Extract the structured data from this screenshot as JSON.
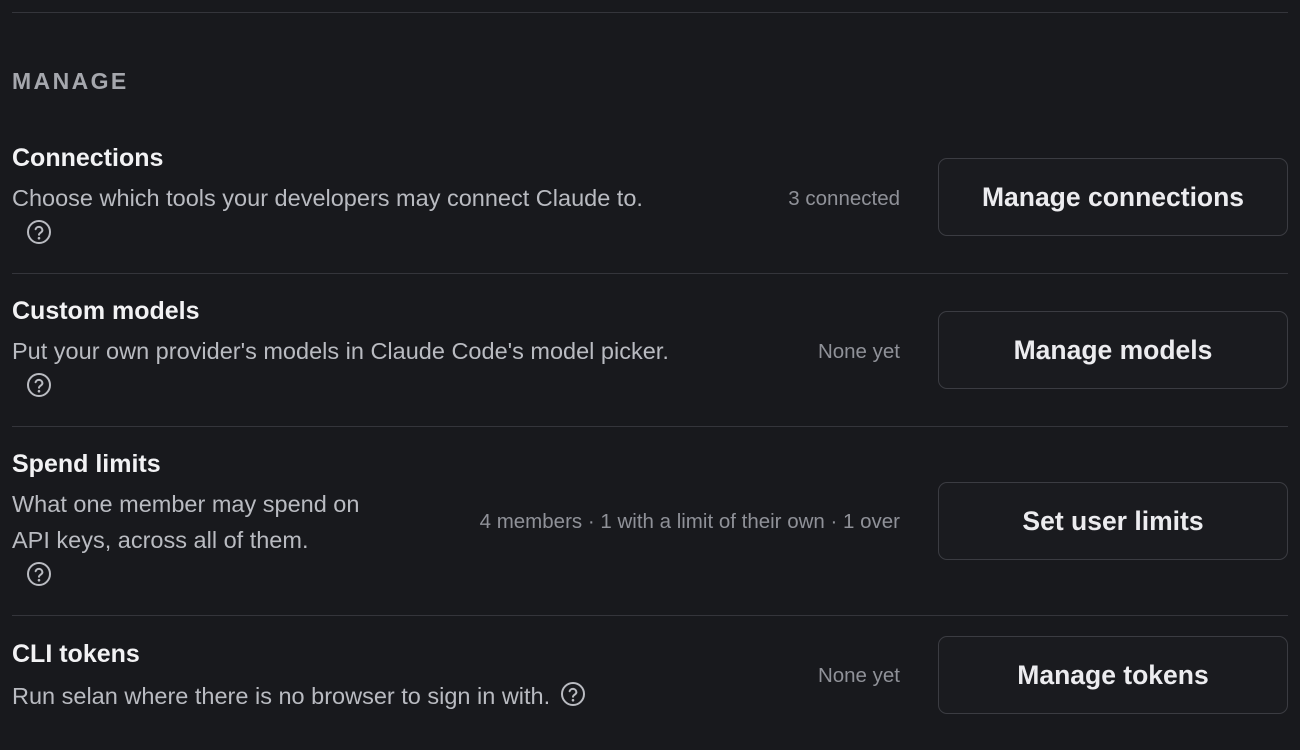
{
  "section": {
    "heading": "MANAGE"
  },
  "rows": [
    {
      "title": "Connections",
      "description": "Choose which tools your developers may connect Claude to.",
      "status": "3 connected",
      "button": "Manage connections",
      "help_icon": "question-circle-icon"
    },
    {
      "title": "Custom models",
      "description": "Put your own provider's models in Claude Code's model picker.",
      "status": "None yet",
      "button": "Manage models",
      "help_icon": "question-circle-icon"
    },
    {
      "title": "Spend limits",
      "description": "What one member may spend on API keys, across all of them.",
      "status": "4 members · 1 with a limit of their own · 1 over",
      "button": "Set user limits",
      "help_icon": "question-circle-icon"
    },
    {
      "title": "CLI tokens",
      "description": "Run selan where there is no browser to sign in with.",
      "status": "None yet",
      "button": "Manage tokens",
      "help_icon": "question-circle-icon"
    }
  ],
  "colors": {
    "background": "#18191d",
    "title": "#f2f2f4",
    "description": "#b9bbc1",
    "status": "#8f9198",
    "border": "#3b3c42"
  }
}
